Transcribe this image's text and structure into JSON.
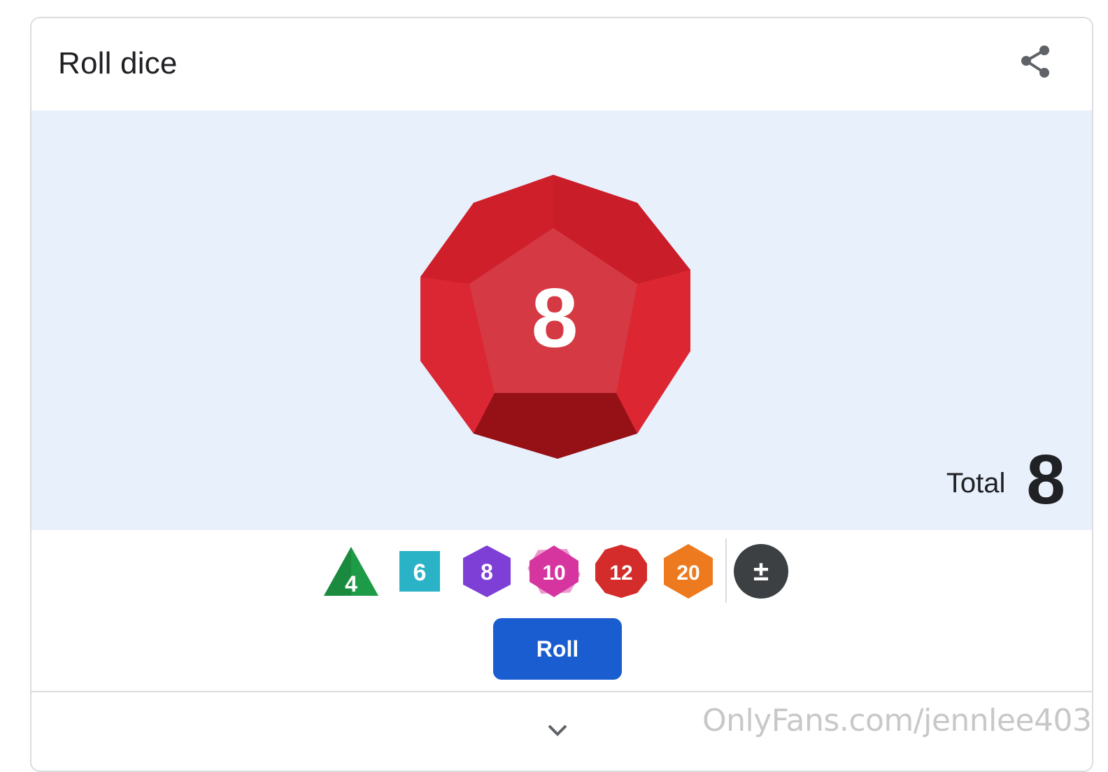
{
  "header": {
    "title": "Roll dice",
    "share_icon": "share-icon"
  },
  "result": {
    "die_type": "d12",
    "face_value": "8",
    "total_label": "Total",
    "total_value": "8",
    "die_color": "#d8232f"
  },
  "dice_picker": {
    "dice": [
      {
        "sides": "d4",
        "label": "4",
        "color": "#1e9b47"
      },
      {
        "sides": "d6",
        "label": "6",
        "color": "#2ab3c7"
      },
      {
        "sides": "d8",
        "label": "8",
        "color": "#7d3fd6"
      },
      {
        "sides": "d10",
        "label": "10",
        "color": "#d6359f"
      },
      {
        "sides": "d12",
        "label": "12",
        "color": "#d42b2b"
      },
      {
        "sides": "d20",
        "label": "20",
        "color": "#ee7a1f"
      }
    ],
    "modifier_label": "±",
    "modifier_color": "#3c4043"
  },
  "actions": {
    "roll_label": "Roll",
    "roll_color": "#1a5dd1",
    "expand_icon": "chevron-down-icon"
  },
  "watermark": "OnlyFans.com/jennlee403"
}
